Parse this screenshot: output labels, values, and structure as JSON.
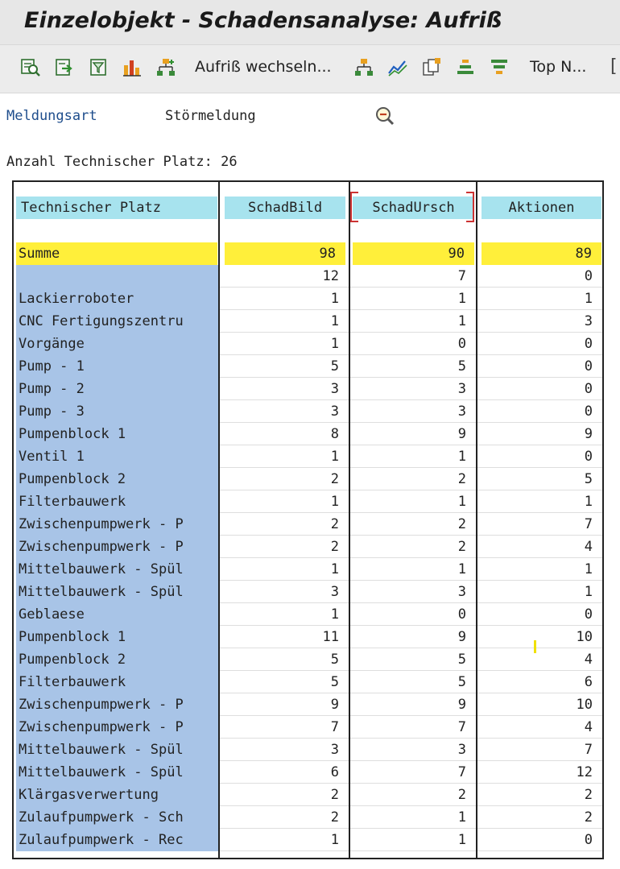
{
  "window": {
    "title": "Einzelobjekt - Schadensanalyse: Aufriß"
  },
  "toolbar": {
    "icons": [
      "detail-icon",
      "export-icon",
      "filter-icon",
      "chart-icon",
      "hierarchy-icon",
      "org-structure-icon",
      "line-chart-icon",
      "copy-icon",
      "sort-icon",
      "funnel-icon"
    ],
    "switch_label": "Aufriß wechseln...",
    "topn_label": "Top N...",
    "overflow": "["
  },
  "selection": {
    "label": "Meldungsart",
    "value": "Störmeldung"
  },
  "summary": {
    "count_label": "Anzahl Technischer Platz:",
    "count_value": "26"
  },
  "colors": {
    "header_bg": "#a7e3ee",
    "name_bg": "#a8c4e7",
    "sum_bg": "#ffef3a",
    "label_blue": "#1e4d8c",
    "selected_border": "#cc3333"
  },
  "table": {
    "columns": [
      "Technischer Platz",
      "SchadBild",
      "SchadUrsch",
      "Aktionen"
    ],
    "sum_row": {
      "label": "Summe",
      "values": [
        "98",
        "90",
        "89"
      ]
    },
    "rows": [
      {
        "name": "",
        "values": [
          "12",
          "7",
          "0"
        ]
      },
      {
        "name": "Lackierroboter",
        "values": [
          "1",
          "1",
          "1"
        ]
      },
      {
        "name": "CNC Fertigungszentru",
        "values": [
          "1",
          "1",
          "3"
        ]
      },
      {
        "name": "Vorgänge",
        "values": [
          "1",
          "0",
          "0"
        ]
      },
      {
        "name": "Pump - 1",
        "values": [
          "5",
          "5",
          "0"
        ]
      },
      {
        "name": "Pump - 2",
        "values": [
          "3",
          "3",
          "0"
        ]
      },
      {
        "name": "Pump - 3",
        "values": [
          "3",
          "3",
          "0"
        ]
      },
      {
        "name": "Pumpenblock 1",
        "values": [
          "8",
          "9",
          "9"
        ]
      },
      {
        "name": "Ventil 1",
        "values": [
          "1",
          "1",
          "0"
        ]
      },
      {
        "name": "Pumpenblock 2",
        "values": [
          "2",
          "2",
          "5"
        ]
      },
      {
        "name": "Filterbauwerk",
        "values": [
          "1",
          "1",
          "1"
        ]
      },
      {
        "name": "Zwischenpumpwerk - P",
        "values": [
          "2",
          "2",
          "7"
        ]
      },
      {
        "name": "Zwischenpumpwerk - P",
        "values": [
          "2",
          "2",
          "4"
        ]
      },
      {
        "name": "Mittelbauwerk - Spül",
        "values": [
          "1",
          "1",
          "1"
        ]
      },
      {
        "name": "Mittelbauwerk - Spül",
        "values": [
          "3",
          "3",
          "1"
        ]
      },
      {
        "name": "Geblaese",
        "values": [
          "1",
          "0",
          "0"
        ]
      },
      {
        "name": "Pumpenblock 1",
        "values": [
          "11",
          "9",
          "10"
        ]
      },
      {
        "name": "Pumpenblock 2",
        "values": [
          "5",
          "5",
          "4"
        ]
      },
      {
        "name": "Filterbauwerk",
        "values": [
          "5",
          "5",
          "6"
        ]
      },
      {
        "name": "Zwischenpumpwerk - P",
        "values": [
          "9",
          "9",
          "10"
        ]
      },
      {
        "name": "Zwischenpumpwerk - P",
        "values": [
          "7",
          "7",
          "4"
        ]
      },
      {
        "name": "Mittelbauwerk - Spül",
        "values": [
          "3",
          "3",
          "7"
        ]
      },
      {
        "name": "Mittelbauwerk - Spül",
        "values": [
          "6",
          "7",
          "12"
        ]
      },
      {
        "name": "Klärgasverwertung",
        "values": [
          "2",
          "2",
          "2"
        ]
      },
      {
        "name": "Zulaufpumpwerk - Sch",
        "values": [
          "2",
          "1",
          "2"
        ]
      },
      {
        "name": "Zulaufpumpwerk - Rec",
        "values": [
          "1",
          "1",
          "0"
        ]
      }
    ]
  }
}
